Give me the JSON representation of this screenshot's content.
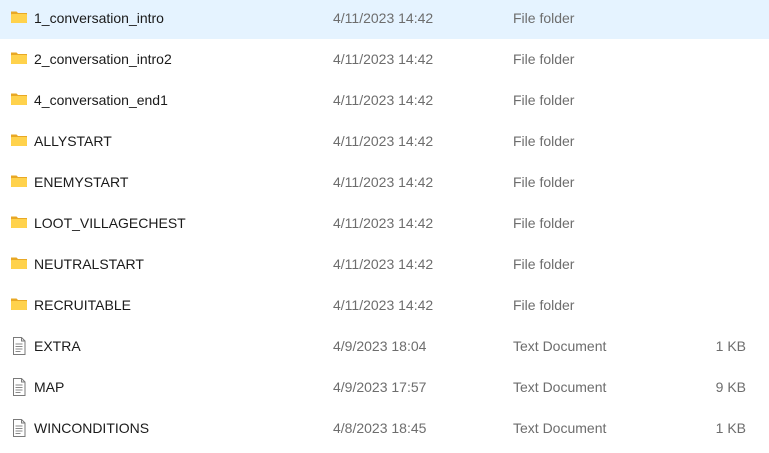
{
  "rows": [
    {
      "name": "1_conversation_intro",
      "date": "4/11/2023 14:42",
      "type": "File folder",
      "size": "",
      "icon": "folder-icon"
    },
    {
      "name": "2_conversation_intro2",
      "date": "4/11/2023 14:42",
      "type": "File folder",
      "size": "",
      "icon": "folder-icon"
    },
    {
      "name": "4_conversation_end1",
      "date": "4/11/2023 14:42",
      "type": "File folder",
      "size": "",
      "icon": "folder-icon"
    },
    {
      "name": "ALLYSTART",
      "date": "4/11/2023 14:42",
      "type": "File folder",
      "size": "",
      "icon": "folder-icon"
    },
    {
      "name": "ENEMYSTART",
      "date": "4/11/2023 14:42",
      "type": "File folder",
      "size": "",
      "icon": "folder-icon"
    },
    {
      "name": "LOOT_VILLAGECHEST",
      "date": "4/11/2023 14:42",
      "type": "File folder",
      "size": "",
      "icon": "folder-icon"
    },
    {
      "name": "NEUTRALSTART",
      "date": "4/11/2023 14:42",
      "type": "File folder",
      "size": "",
      "icon": "folder-icon"
    },
    {
      "name": "RECRUITABLE",
      "date": "4/11/2023 14:42",
      "type": "File folder",
      "size": "",
      "icon": "folder-icon"
    },
    {
      "name": "EXTRA",
      "date": "4/9/2023 18:04",
      "type": "Text Document",
      "size": "1 KB",
      "icon": "text-document-icon"
    },
    {
      "name": "MAP",
      "date": "4/9/2023 17:57",
      "type": "Text Document",
      "size": "9 KB",
      "icon": "text-document-icon"
    },
    {
      "name": "WINCONDITIONS",
      "date": "4/8/2023 18:45",
      "type": "Text Document",
      "size": "1 KB",
      "icon": "text-document-icon"
    }
  ],
  "colors": {
    "folder_front": "#ffd24c",
    "folder_back": "#e8a825",
    "text_primary": "#1a1a1a",
    "text_secondary": "#6d6d6d",
    "doc_outline": "#7a7a7a"
  }
}
